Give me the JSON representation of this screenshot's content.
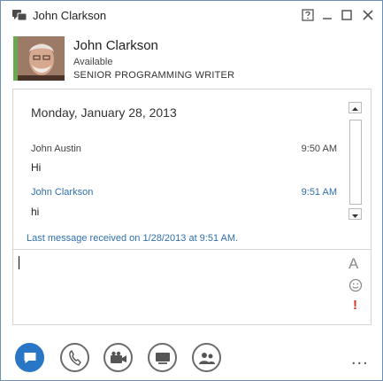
{
  "window": {
    "title": "John Clarkson"
  },
  "contact": {
    "name": "John Clarkson",
    "status": "Available",
    "job_title": "SENIOR PROGRAMMING WRITER",
    "presence_color": "#6aa84f"
  },
  "conversation": {
    "date_heading": "Monday, January 28, 2013",
    "messages": [
      {
        "sender": "John Austin",
        "time": "9:50 AM",
        "text": "Hi"
      },
      {
        "sender": "John Clarkson",
        "time": "9:51 AM",
        "text": "hi"
      }
    ],
    "last_received": "Last message received on 1/28/2013 at 9:51 AM."
  },
  "compose": {
    "value": "",
    "font_label": "A",
    "important_label": "!"
  },
  "toolbar": {
    "items": [
      "im-icon",
      "phone-icon",
      "video-icon",
      "present-icon",
      "people-icon"
    ],
    "more_label": "..."
  },
  "colors": {
    "accent": "#2a76c6",
    "link": "#2f6fad",
    "important": "#d93025"
  }
}
